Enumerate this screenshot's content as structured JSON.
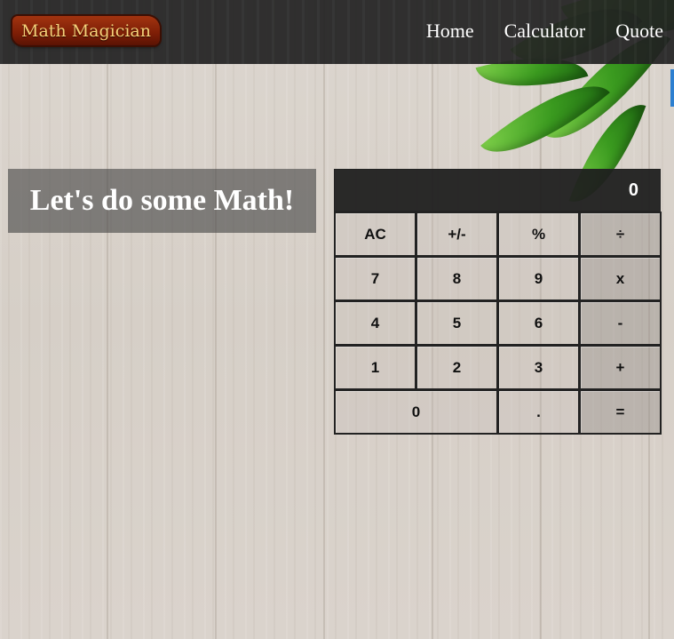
{
  "nav": {
    "logo_text": "Math Magician",
    "links": [
      "Home",
      "Calculator",
      "Quote"
    ]
  },
  "hero": {
    "title": "Let's do some Math!"
  },
  "calculator": {
    "display_value": "0",
    "keys": {
      "row1": [
        "AC",
        "+/-",
        "%",
        "÷"
      ],
      "row2": [
        "7",
        "8",
        "9",
        "x"
      ],
      "row3": [
        "4",
        "5",
        "6",
        "-"
      ],
      "row4": [
        "1",
        "2",
        "3",
        "+"
      ],
      "row5": [
        "0",
        ".",
        "="
      ]
    }
  },
  "colors": {
    "navbar": "#222222",
    "logo_bg": "#7d1e06",
    "logo_text": "#f7d27a",
    "display_bg": "#1e1e1e"
  }
}
